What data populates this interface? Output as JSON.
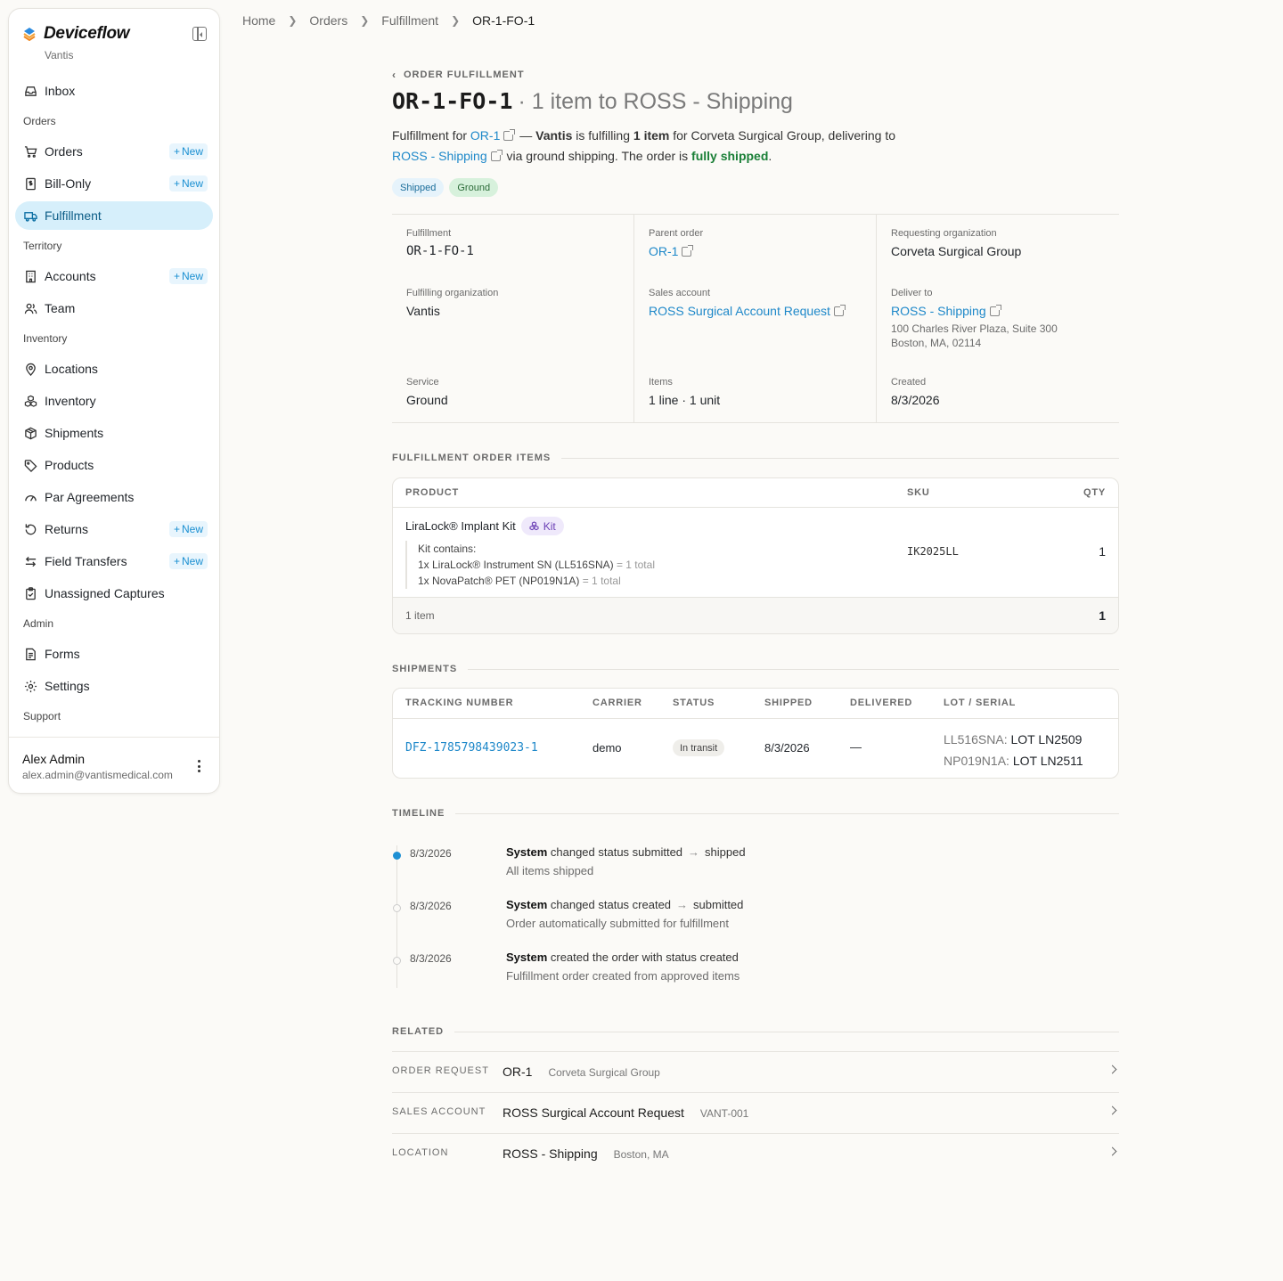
{
  "brand": {
    "name": "Deviceflow",
    "org": "Vantis"
  },
  "sidebar": {
    "inbox": "Inbox",
    "sections": {
      "orders": "Orders",
      "territory": "Territory",
      "inventory": "Inventory",
      "admin": "Admin",
      "support": "Support"
    },
    "items": {
      "orders": "Orders",
      "bill_only": "Bill-Only",
      "fulfillment": "Fulfillment",
      "accounts": "Accounts",
      "team": "Team",
      "locations": "Locations",
      "inventory": "Inventory",
      "shipments": "Shipments",
      "products": "Products",
      "par_agreements": "Par Agreements",
      "returns": "Returns",
      "field_transfers": "Field Transfers",
      "unassigned_captures": "Unassigned Captures",
      "forms": "Forms",
      "settings": "Settings"
    },
    "new_label": "New",
    "user": {
      "name": "Alex Admin",
      "email": "alex.admin@vantismedical.com"
    }
  },
  "breadcrumb": [
    "Home",
    "Orders",
    "Fulfillment",
    "OR-1-FO-1"
  ],
  "header": {
    "eyebrow": "ORDER FULFILLMENT",
    "id": "OR-1-FO-1",
    "subtitle": "· 1 item to ROSS - Shipping",
    "desc": {
      "p1": "Fulfillment for",
      "order_link": "OR-1",
      "p2": "—",
      "org": "Vantis",
      "p3": "is fulfilling",
      "items": "1 item",
      "p4": "for Corveta Surgical Group, delivering to",
      "dest_link": "ROSS - Shipping",
      "p5": "via ground shipping. The order is",
      "status": "fully shipped",
      "p6": "."
    },
    "badges": {
      "status": "Shipped",
      "service": "Ground"
    }
  },
  "info": {
    "fulfillment": {
      "label": "Fulfillment",
      "value": "OR-1-FO-1"
    },
    "parent_order": {
      "label": "Parent order",
      "value": "OR-1"
    },
    "requesting_org": {
      "label": "Requesting organization",
      "value": "Corveta Surgical Group"
    },
    "fulfilling_org": {
      "label": "Fulfilling organization",
      "value": "Vantis"
    },
    "sales_account": {
      "label": "Sales account",
      "value": "ROSS Surgical Account Request"
    },
    "deliver_to": {
      "label": "Deliver to",
      "value": "ROSS - Shipping",
      "addr1": "100 Charles River Plaza, Suite 300",
      "addr2": "Boston, MA, 02114"
    },
    "service": {
      "label": "Service",
      "value": "Ground"
    },
    "items": {
      "label": "Items",
      "value": "1 line · 1 unit"
    },
    "created": {
      "label": "Created",
      "value": "8/3/2026"
    }
  },
  "items_section": {
    "title": "FULFILLMENT ORDER ITEMS",
    "headers": {
      "product": "PRODUCT",
      "sku": "SKU",
      "qty": "QTY"
    },
    "row": {
      "product": "LiraLock® Implant Kit",
      "badge": "Kit",
      "contains_label": "Kit contains:",
      "line1": "1x LiraLock® Instrument SN (LL516SNA)",
      "line1_total": "= 1 total",
      "line2": "1x NovaPatch® PET (NP019N1A)",
      "line2_total": "= 1 total",
      "sku": "IK2025LL",
      "qty": "1"
    },
    "footer": {
      "count": "1 item",
      "total": "1"
    }
  },
  "shipments": {
    "title": "SHIPMENTS",
    "headers": {
      "tracking": "TRACKING NUMBER",
      "carrier": "CARRIER",
      "status": "STATUS",
      "shipped": "SHIPPED",
      "delivered": "DELIVERED",
      "lot": "LOT / SERIAL"
    },
    "row": {
      "tracking": "DFZ-1785798439023-1",
      "carrier": "demo",
      "status": "In transit",
      "shipped": "8/3/2026",
      "delivered": "—",
      "lot1_sku": "LL516SNA:",
      "lot1_val": "LOT LN2509",
      "lot2_sku": "NP019N1A:",
      "lot2_val": "LOT LN2511"
    }
  },
  "timeline": {
    "title": "TIMELINE",
    "events": [
      {
        "date": "8/3/2026",
        "actor": "System",
        "action": "changed status submitted",
        "arrow": "→",
        "to": "shipped",
        "note": "All items shipped"
      },
      {
        "date": "8/3/2026",
        "actor": "System",
        "action": "changed status created",
        "arrow": "→",
        "to": "submitted",
        "note": "Order automatically submitted for fulfillment"
      },
      {
        "date": "8/3/2026",
        "actor": "System",
        "action": "created the order with status created",
        "arrow": "",
        "to": "",
        "note": "Fulfillment order created from approved items"
      }
    ]
  },
  "related": {
    "title": "RELATED",
    "rows": [
      {
        "label": "ORDER REQUEST",
        "main": "OR-1",
        "sub": "Corveta Surgical Group"
      },
      {
        "label": "SALES ACCOUNT",
        "main": "ROSS Surgical Account Request",
        "sub": "VANT-001"
      },
      {
        "label": "LOCATION",
        "main": "ROSS - Shipping",
        "sub": "Boston, MA"
      }
    ]
  }
}
